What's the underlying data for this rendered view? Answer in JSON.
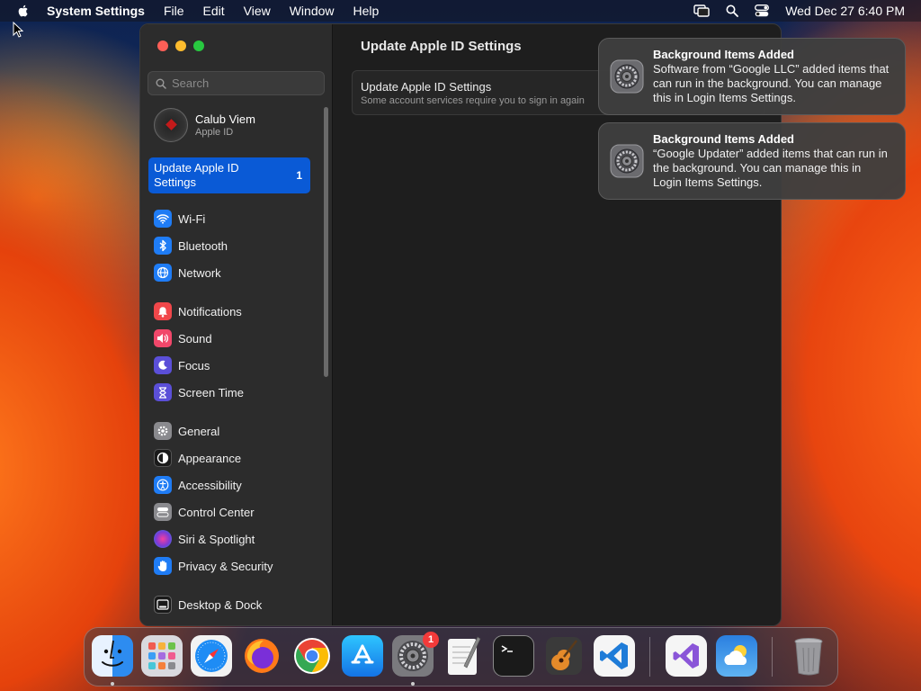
{
  "menubar": {
    "app_name": "System Settings",
    "items": [
      "File",
      "Edit",
      "View",
      "Window",
      "Help"
    ],
    "datetime": "Wed Dec 27  6:40 PM"
  },
  "sidebar": {
    "search_placeholder": "Search",
    "account": {
      "name": "Calub Viem",
      "subtitle": "Apple ID"
    },
    "selected": {
      "label": "Update Apple ID Settings",
      "badge": "1"
    },
    "groups": [
      [
        {
          "label": "Wi-Fi",
          "icon": "wifi-icon",
          "color": "#1f7cf5"
        },
        {
          "label": "Bluetooth",
          "icon": "bluetooth-icon",
          "color": "#1f7cf5"
        },
        {
          "label": "Network",
          "icon": "globe-icon",
          "color": "#1f7cf5"
        }
      ],
      [
        {
          "label": "Notifications",
          "icon": "bell-icon",
          "color": "#f1474a"
        },
        {
          "label": "Sound",
          "icon": "speaker-icon",
          "color": "#f1476a"
        },
        {
          "label": "Focus",
          "icon": "moon-icon",
          "color": "#5b4fd8"
        },
        {
          "label": "Screen Time",
          "icon": "hourglass-icon",
          "color": "#5b4fd8"
        }
      ],
      [
        {
          "label": "General",
          "icon": "gear-icon",
          "color": "#8a8a8e"
        },
        {
          "label": "Appearance",
          "icon": "appearance-icon",
          "color": "#2a2a2a"
        },
        {
          "label": "Accessibility",
          "icon": "accessibility-icon",
          "color": "#1f7cf5"
        },
        {
          "label": "Control Center",
          "icon": "control-center-icon",
          "color": "#8a8a8e"
        },
        {
          "label": "Siri & Spotlight",
          "icon": "siri-icon",
          "color": "#b040d0"
        },
        {
          "label": "Privacy & Security",
          "icon": "hand-icon",
          "color": "#1f7cf5"
        }
      ],
      [
        {
          "label": "Desktop & Dock",
          "icon": "dock-icon",
          "color": "#2a2a2a"
        }
      ]
    ]
  },
  "main": {
    "title": "Update Apple ID Settings",
    "card_title": "Update Apple ID Settings",
    "card_subtitle": "Some account services require you to sign in again"
  },
  "notifications": [
    {
      "title": "Background Items Added",
      "body": "Software from “Google LLC” added items that can run in the background. You can manage this in Login Items Settings."
    },
    {
      "title": "Background Items Added",
      "body": "“Google Updater” added items that can run in the background. You can manage this in Login Items Settings."
    }
  ],
  "dock": {
    "settings_badge": "1",
    "apps": [
      "finder",
      "launchpad",
      "safari",
      "firefox",
      "chrome",
      "app-store",
      "system-settings",
      "textedit",
      "terminal",
      "garageband",
      "vscode",
      "visual-studio",
      "weather",
      "trash"
    ]
  }
}
